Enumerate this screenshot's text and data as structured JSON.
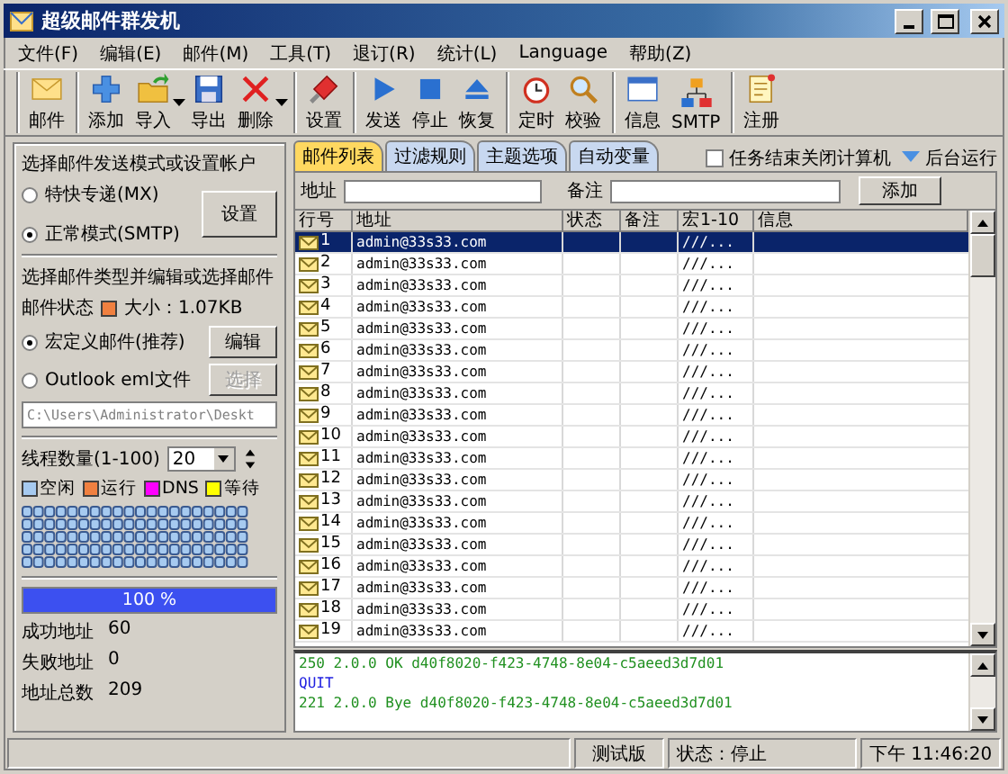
{
  "window": {
    "title": "超级邮件群发机"
  },
  "menu": [
    "文件(F)",
    "编辑(E)",
    "邮件(M)",
    "工具(T)",
    "退订(R)",
    "统计(L)",
    "Language",
    "帮助(Z)"
  ],
  "toolbar": [
    [
      {
        "label": "邮件",
        "dropdown": false
      }
    ],
    [
      {
        "label": "添加",
        "dropdown": false
      },
      {
        "label": "导入",
        "dropdown": true
      },
      {
        "label": "导出",
        "dropdown": false
      },
      {
        "label": "删除",
        "dropdown": true
      }
    ],
    [
      {
        "label": "设置",
        "dropdown": false
      }
    ],
    [
      {
        "label": "发送",
        "dropdown": false
      },
      {
        "label": "停止",
        "dropdown": false
      },
      {
        "label": "恢复",
        "dropdown": false
      }
    ],
    [
      {
        "label": "定时",
        "dropdown": false
      },
      {
        "label": "校验",
        "dropdown": false
      }
    ],
    [
      {
        "label": "信息",
        "dropdown": false
      },
      {
        "label": "SMTP",
        "dropdown": false
      }
    ],
    [
      {
        "label": "注册",
        "dropdown": false
      }
    ]
  ],
  "left": {
    "mode_title": "选择邮件发送模式或设置帐户",
    "modes": [
      {
        "label": "特快专递(MX)",
        "selected": false
      },
      {
        "label": "正常模式(SMTP)",
        "selected": true
      }
    ],
    "settings_button": "设置",
    "type_title": "选择邮件类型并编辑或选择邮件",
    "mail_status": {
      "label": "邮件状态",
      "color": "#f08040",
      "size": "大小：1.07KB"
    },
    "mail_types": [
      {
        "label": "宏定义邮件(推荐)",
        "selected": true,
        "button": "编辑",
        "disabled": false
      },
      {
        "label": "Outlook eml文件",
        "selected": false,
        "button": "选择",
        "disabled": true
      }
    ],
    "path": "C:\\Users\\Administrator\\Deskt",
    "threads": {
      "label": "线程数量(1-100)",
      "value": "20"
    },
    "legend": [
      {
        "label": "空闲",
        "color": "#a6caf0"
      },
      {
        "label": "运行",
        "color": "#f08040"
      },
      {
        "label": "DNS",
        "color": "#ff00ff"
      },
      {
        "label": "等待",
        "color": "#ffff00"
      }
    ],
    "progress": {
      "level": 1,
      "text": "100 %"
    },
    "stats": [
      {
        "label": "成功地址",
        "value": "60"
      },
      {
        "label": "失败地址",
        "value": "0"
      },
      {
        "label": "地址总数",
        "value": "209"
      }
    ]
  },
  "tabs": [
    {
      "label": "邮件列表",
      "selected": true
    },
    {
      "label": "过滤规则",
      "selected": false
    },
    {
      "label": "主题选项",
      "selected": false
    },
    {
      "label": "自动变量",
      "selected": false
    }
  ],
  "shutdown": {
    "label": "任务结束关闭计算机",
    "checked": false
  },
  "background_run": "后台运行",
  "filter": {
    "address_label": "地址",
    "note_label": "备注",
    "add_button": "添加"
  },
  "table": {
    "columns": [
      "行号",
      "地址",
      "状态",
      "备注",
      "宏1-10",
      "信息"
    ],
    "rows": [
      {
        "num": "1",
        "address": "admin@33s33.com",
        "macro": "///...",
        "selected": true
      },
      {
        "num": "2",
        "address": "admin@33s33.com",
        "macro": "///...",
        "selected": false
      },
      {
        "num": "3",
        "address": "admin@33s33.com",
        "macro": "///...",
        "selected": false
      },
      {
        "num": "4",
        "address": "admin@33s33.com",
        "macro": "///...",
        "selected": false
      },
      {
        "num": "5",
        "address": "admin@33s33.com",
        "macro": "///...",
        "selected": false
      },
      {
        "num": "6",
        "address": "admin@33s33.com",
        "macro": "///...",
        "selected": false
      },
      {
        "num": "7",
        "address": "admin@33s33.com",
        "macro": "///...",
        "selected": false
      },
      {
        "num": "8",
        "address": "admin@33s33.com",
        "macro": "///...",
        "selected": false
      },
      {
        "num": "9",
        "address": "admin@33s33.com",
        "macro": "///...",
        "selected": false
      },
      {
        "num": "10",
        "address": "admin@33s33.com",
        "macro": "///...",
        "selected": false
      },
      {
        "num": "11",
        "address": "admin@33s33.com",
        "macro": "///...",
        "selected": false
      },
      {
        "num": "12",
        "address": "admin@33s33.com",
        "macro": "///...",
        "selected": false
      },
      {
        "num": "13",
        "address": "admin@33s33.com",
        "macro": "///...",
        "selected": false
      },
      {
        "num": "14",
        "address": "admin@33s33.com",
        "macro": "///...",
        "selected": false
      },
      {
        "num": "15",
        "address": "admin@33s33.com",
        "macro": "///...",
        "selected": false
      },
      {
        "num": "16",
        "address": "admin@33s33.com",
        "macro": "///...",
        "selected": false
      },
      {
        "num": "17",
        "address": "admin@33s33.com",
        "macro": "///...",
        "selected": false
      },
      {
        "num": "18",
        "address": "admin@33s33.com",
        "macro": "///...",
        "selected": false
      },
      {
        "num": "19",
        "address": "admin@33s33.com",
        "macro": "///...",
        "selected": false
      }
    ]
  },
  "log": [
    {
      "kind": "response",
      "text": "250 2.0.0 OK d40f8020-f423-4748-8e04-c5aeed3d7d01"
    },
    {
      "kind": "command",
      "text": "QUIT"
    },
    {
      "kind": "response",
      "text": "221 2.0.0 Bye d40f8020-f423-4748-8e04-c5aeed3d7d01"
    }
  ],
  "status_bar": {
    "edition": "测试版",
    "state": "状态：停止",
    "time": "下午 11:46:20"
  }
}
